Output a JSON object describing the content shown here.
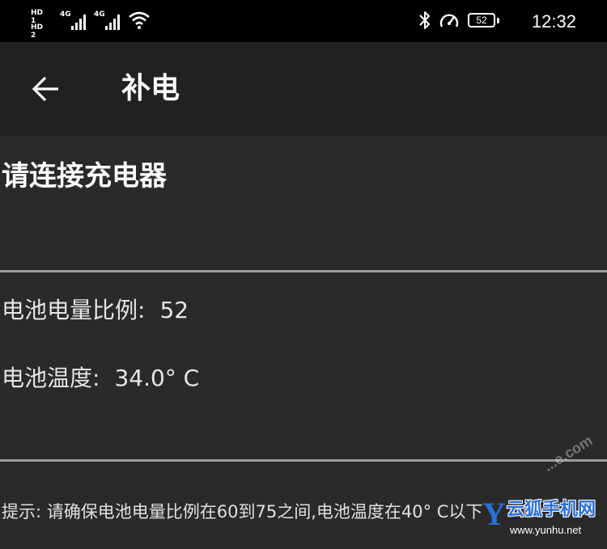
{
  "status_bar": {
    "sim1_label": "HD 1",
    "sim2_label": "HD 2",
    "sim1_network": "4G",
    "sim2_network": "4G",
    "battery_level": "52",
    "time": "12:32",
    "icons": [
      "bluetooth-icon",
      "speedometer-icon",
      "wifi-icon",
      "signal-icon"
    ]
  },
  "app_bar": {
    "title": "补电",
    "back_icon": "arrow-left-icon"
  },
  "content": {
    "charger_prompt": "请连接充电器",
    "battery_ratio_label": "电池电量比例:",
    "battery_ratio_value": "52",
    "battery_temp_label": "电池温度:",
    "battery_temp_value": "34.0° C",
    "hint": "提示: 请确保电池电量比例在60到75之间,电池温度在40° C以下"
  },
  "watermark": {
    "letter": "Y",
    "name": "云狐手机网",
    "url": "www.yunhu.net",
    "faint": "...e.com"
  },
  "colors": {
    "status_bar_bg": "#000000",
    "app_bar_bg": "#212121",
    "content_bg": "#2a2a2a",
    "divider": "#9c9c9c",
    "watermark_blue": "#2a6fd6"
  }
}
